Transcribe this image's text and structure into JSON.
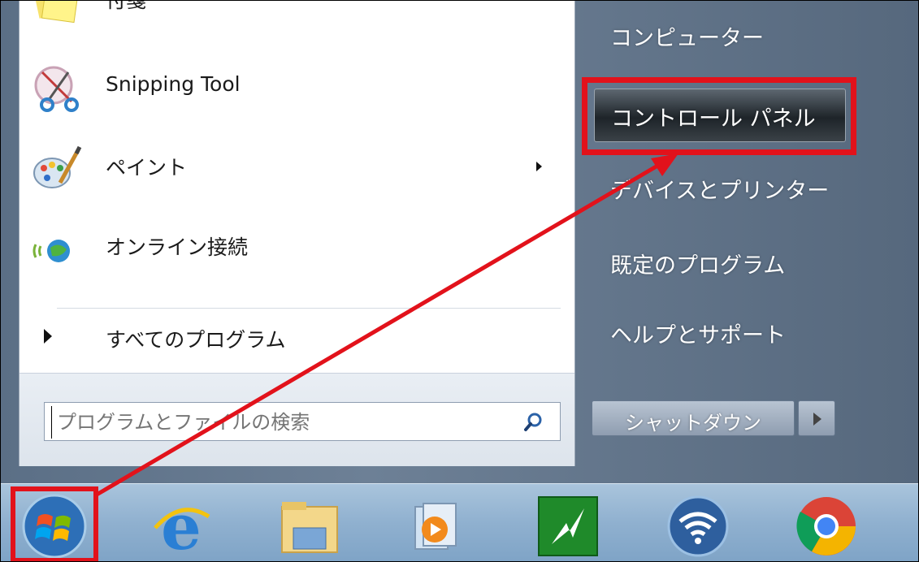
{
  "start_menu": {
    "left_items": [
      {
        "label": "付箋",
        "icon": "sticky-notes-icon"
      },
      {
        "label": "Snipping Tool",
        "icon": "snipping-tool-icon"
      },
      {
        "label": "ペイント",
        "icon": "paint-icon",
        "has_submenu": true
      },
      {
        "label": "オンライン接続",
        "icon": "online-connect-icon"
      }
    ],
    "all_programs_label": "すべてのプログラム",
    "search_placeholder": "プログラムとファイルの検索",
    "right_items": [
      {
        "label": "コンピューター"
      },
      {
        "label": "コントロール パネル",
        "highlighted": true
      },
      {
        "label": "デバイスとプリンター"
      },
      {
        "label": "既定のプログラム"
      },
      {
        "label": "ヘルプとサポート"
      }
    ],
    "shutdown_label": "シャットダウン"
  },
  "taskbar": {
    "icons": [
      "start-orb-icon",
      "internet-explorer-icon",
      "file-explorer-icon",
      "media-player-icon",
      "green-app-icon",
      "wifi-app-icon",
      "chrome-icon"
    ]
  },
  "annotation": {
    "highlight_color": "#e2121b"
  }
}
